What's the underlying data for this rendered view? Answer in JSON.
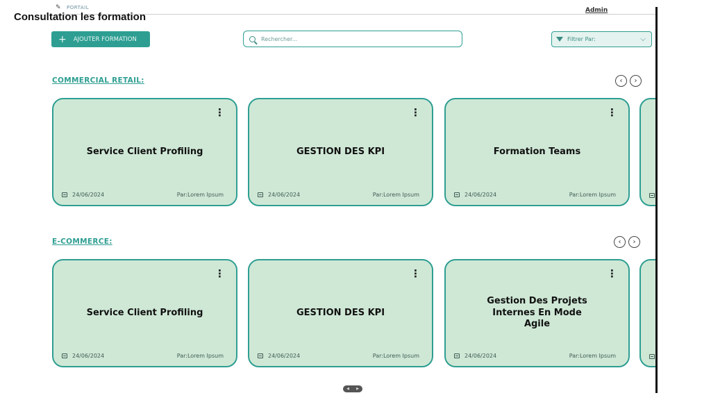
{
  "header": {
    "portal": "PORTAIL",
    "user": "Admin",
    "page_title": "Consultation les formation"
  },
  "toolbar": {
    "add_label": "AJOUTER FORMATION",
    "search_placeholder": "Rechercher...",
    "filter_label": "Filtrer Par:"
  },
  "sections": [
    {
      "title": "COMMERCIAL RETAIL:",
      "cards": [
        {
          "title": "Service Client Profiling",
          "date": "24/06/2024",
          "author": "Par:Lorem Ipsum"
        },
        {
          "title": "GESTION DES KPI",
          "date": "24/06/2024",
          "author": "Par:Lorem Ipsum"
        },
        {
          "title": "Formation Teams",
          "date": "24/06/2024",
          "author": "Par:Lorem Ipsum"
        }
      ]
    },
    {
      "title": "E-COMMERCE:",
      "cards": [
        {
          "title": "Service Client Profiling",
          "date": "24/06/2024",
          "author": "Par:Lorem Ipsum"
        },
        {
          "title": "GESTION DES KPI",
          "date": "24/06/2024",
          "author": "Par:Lorem Ipsum"
        },
        {
          "title": "Gestion Des Projets Internes En Mode Agile",
          "date": "24/06/2024",
          "author": "Par:Lorem Ipsum"
        }
      ]
    }
  ],
  "icons": {
    "nav_prev": "chevron-left-icon",
    "nav_next": "chevron-right-icon",
    "card_menu": "more-vertical-icon",
    "date": "calendar-icon"
  },
  "colors": {
    "accent": "#2e9e92",
    "card_bg": "#cfe8d6"
  }
}
